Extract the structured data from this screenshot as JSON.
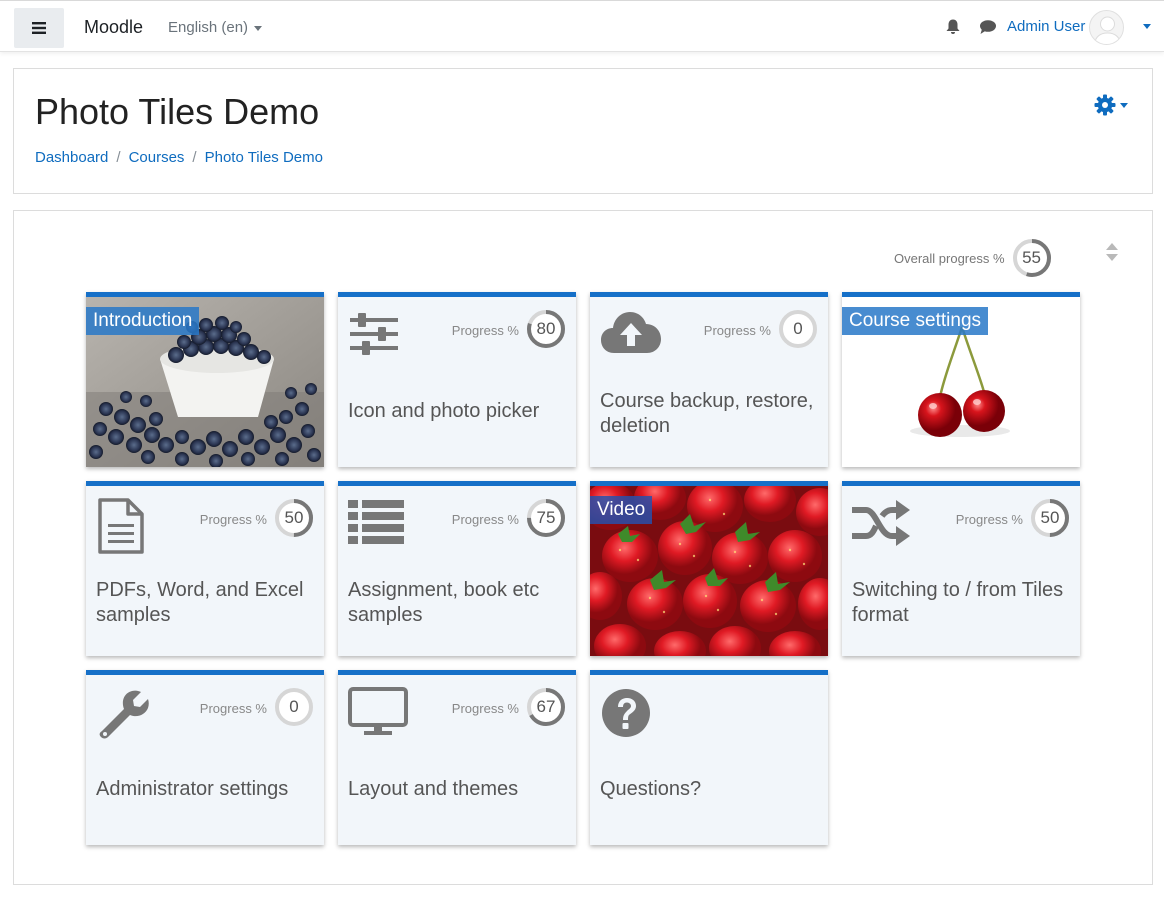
{
  "navbar": {
    "brand": "Moodle",
    "language": "English (en)",
    "user_name": "Admin User"
  },
  "header": {
    "title": "Photo Tiles Demo",
    "breadcrumb": [
      "Dashboard",
      "Courses",
      "Photo Tiles Demo"
    ]
  },
  "main": {
    "overall_label": "Overall progress %",
    "overall_value": 55,
    "tiles": [
      {
        "title": "Introduction",
        "photo": true
      },
      {
        "title": "Icon and photo picker",
        "progress_label": "Progress %",
        "progress": 80
      },
      {
        "title": "Course backup, restore, deletion",
        "progress_label": "Progress %",
        "progress": 0
      },
      {
        "title": "Course settings",
        "photo": true
      },
      {
        "title": "PDFs, Word, and Excel samples",
        "progress_label": "Progress %",
        "progress": 50
      },
      {
        "title": "Assignment, book etc samples",
        "progress_label": "Progress %",
        "progress": 75
      },
      {
        "title": "Video",
        "photo": true
      },
      {
        "title": "Switching to / from Tiles format",
        "progress_label": "Progress %",
        "progress": 50
      },
      {
        "title": "Administrator settings",
        "progress_label": "Progress %",
        "progress": 0
      },
      {
        "title": "Layout and themes",
        "progress_label": "Progress %",
        "progress": 67
      },
      {
        "title": "Questions?"
      }
    ]
  },
  "colors": {
    "accent": "#1670c8",
    "link": "#0f6cbf",
    "tile_bg": "#f2f6fa",
    "progress_ring": "#777777",
    "progress_track": "#d6d6d6"
  }
}
